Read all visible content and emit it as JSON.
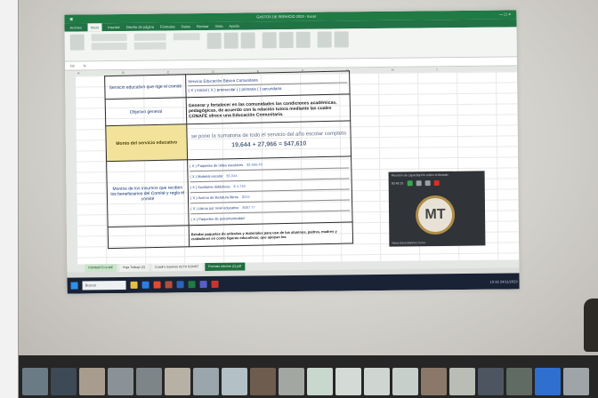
{
  "excel": {
    "title": "GASTOS DE SERVICIO 2023 - Excel",
    "tabs": [
      "Archivo",
      "Inicio",
      "Insertar",
      "Diseño de página",
      "Fórmulas",
      "Datos",
      "Revisar",
      "Vista",
      "Ayuda"
    ],
    "active_tab": "Inicio",
    "formula_bar": {
      "cell_ref": "F8",
      "fx": "fx"
    }
  },
  "table": {
    "row1": {
      "label": "Servicio educativo que rige el comité",
      "value_line1": "Servicio Educación Básica Comunitaria",
      "value_line2": "( X ) Inicial  ( X ) preescolar  (  ) primaria  (  ) secundaria"
    },
    "row2": {
      "label": "Objetivo general",
      "value": "Generar y fortalecer en las comunidades las condiciones académicas, pedagógicas, de acuerdo con la relación tutora mediante las cuales CONAFE ofrece una Educación Comunitaria."
    },
    "row3": {
      "label": "Monto del servicio educativo",
      "value": "se pone la sumatoria de todo el servicio del año escolar completo",
      "formula": "19,644 + 27,966 = $47,610"
    },
    "row4": {
      "label": "Montos de los insumos que reciben los beneficiarios del Comité y regla el comité",
      "items": [
        {
          "text": "( X ) Paquetes de útiles escolares",
          "amount": "$3,966.49"
        },
        {
          "text": "( X ) Material escolar",
          "amount": "$5,044"
        },
        {
          "text": "( X ) Auxiliares didácticos",
          "amount": "$ 4,749"
        },
        {
          "text": "( X ) Acervo de literatura libros",
          "amount": "$244"
        },
        {
          "text": "( X ) Libros por nivel educativo",
          "amount": "$687.77"
        },
        {
          "text": "( X ) Paquetes de psicomotricidad",
          "amount": ""
        }
      ]
    },
    "row5": {
      "label": "",
      "value": "Brindar paquetes de artículos y materiales para uso de los alumnos, padres, madres y cuidadores en como figuras educativas; que apoyan los"
    }
  },
  "sheet_tabs": [
    "FORMATO IV-ME",
    "Hoja Trabajo (2)",
    "Cuadro resumen ACTA CONST",
    "Formato informe (2).pdf"
  ],
  "taskbar": {
    "search_placeholder": "Buscar",
    "time": "10:32",
    "date": "24/11/2023"
  },
  "meeting": {
    "title": "Reunión de capacitación sobre el llenado",
    "timer": "00:48:15",
    "initials": "MT",
    "participant": "María Elena Martínez Torres"
  },
  "colors": {
    "excel_green": "#217346",
    "highlight_yellow": "#f3e39a",
    "taskbar": "#1a2335"
  }
}
